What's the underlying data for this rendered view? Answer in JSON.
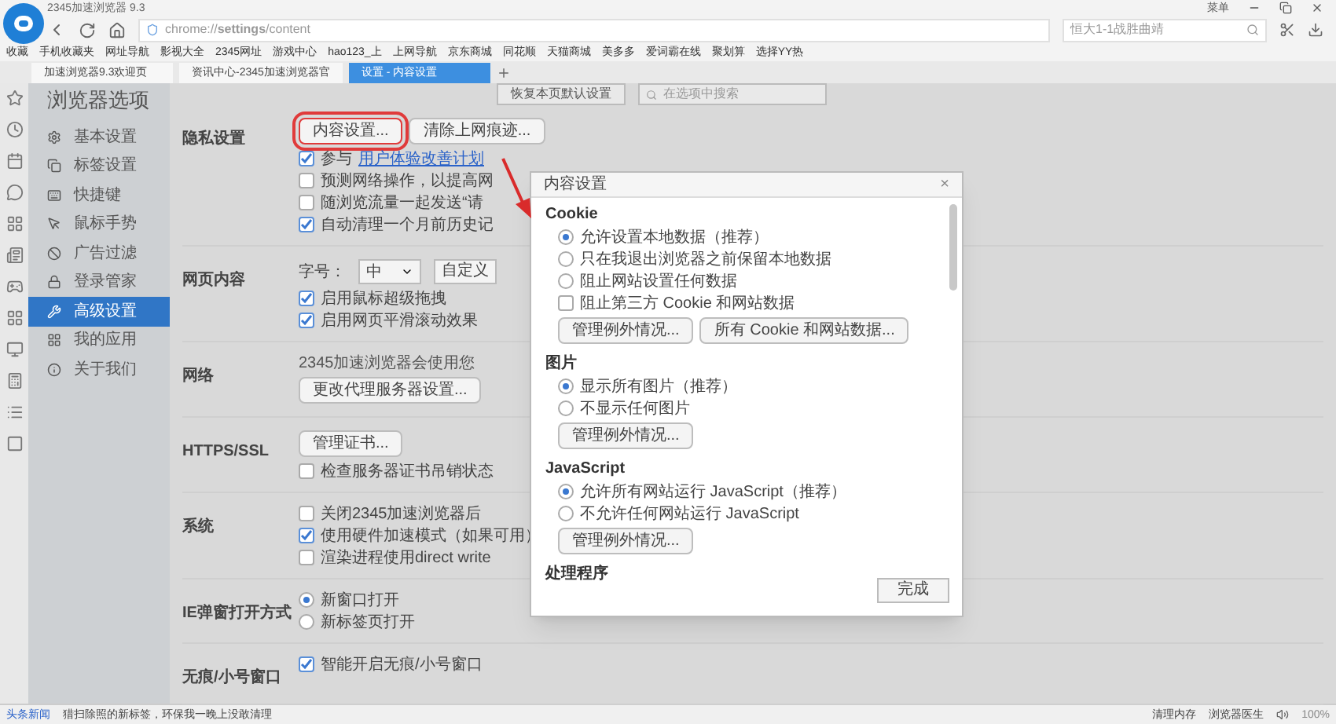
{
  "window": {
    "title": "2345加速浏览器 9.3",
    "menu": "菜单"
  },
  "address": {
    "url": "chrome://**settings**/content"
  },
  "search": {
    "value": "恒大1-1战胜曲靖"
  },
  "bookmarks": [
    "收藏",
    "手机收藏夹",
    "网址导航",
    "影视大全",
    "2345网址",
    "游戏中心",
    "hao123_上",
    "上网导航",
    "京东商城",
    "同花顺",
    "天猫商城",
    "美多多",
    "爱词霸在线",
    "聚划算",
    "选择YY热"
  ],
  "tabs": [
    {
      "label": "加速浏览器9.3欢迎页",
      "selected": false
    },
    {
      "label": "资讯中心-2345加速浏览器官",
      "selected": false
    },
    {
      "label": "设置 - 内容设置",
      "selected": true
    }
  ],
  "page": {
    "title": "浏览器选项",
    "reset_button": "恢复本页默认设置",
    "search_placeholder": "在选项中搜索"
  },
  "sidebar": {
    "items": [
      {
        "label": "基本设置",
        "selected": false
      },
      {
        "label": "标签设置",
        "selected": false
      },
      {
        "label": "快捷键",
        "selected": false
      },
      {
        "label": "鼠标手势",
        "selected": false
      },
      {
        "label": "广告过滤",
        "selected": false
      },
      {
        "label": "登录管家",
        "selected": false
      },
      {
        "label": "高级设置",
        "selected": true
      },
      {
        "label": "我的应用",
        "selected": false
      },
      {
        "label": "关于我们",
        "selected": false
      }
    ]
  },
  "sections": [
    {
      "label": "隐私设置",
      "rows": [
        {
          "kind": "buttons",
          "buttons": [
            {
              "label": "内容设置...",
              "highlighted": true
            },
            {
              "label": "清除上网痕迹...",
              "highlighted": false
            }
          ]
        },
        {
          "kind": "checkbox",
          "label": "参与",
          "link": "用户体验改善计划",
          "checked": true
        },
        {
          "kind": "checkbox",
          "label": "预测网络操作，以提高网",
          "checked": false
        },
        {
          "kind": "checkbox",
          "label": "随浏览流量一起发送“请",
          "checked": false
        },
        {
          "kind": "checkbox",
          "label": "自动清理一个月前历史记",
          "checked": true
        }
      ]
    },
    {
      "label": "网页内容",
      "rows": [
        {
          "kind": "select",
          "label": "字号：",
          "value": "中",
          "button": "自定义"
        },
        {
          "kind": "checkbox",
          "label": "启用鼠标超级拖拽",
          "checked": true
        },
        {
          "kind": "checkbox",
          "label": "启用网页平滑滚动效果",
          "checked": true
        }
      ]
    },
    {
      "label": "网络",
      "rows": [
        {
          "kind": "text",
          "label": "2345加速浏览器会使用您"
        },
        {
          "kind": "buttons",
          "buttons": [
            {
              "label": "更改代理服务器设置...",
              "highlighted": false
            }
          ]
        }
      ]
    },
    {
      "label": "HTTPS/SSL",
      "rows": [
        {
          "kind": "buttons",
          "buttons": [
            {
              "label": "管理证书...",
              "highlighted": false
            }
          ]
        },
        {
          "kind": "checkbox",
          "label": "检查服务器证书吊销状态",
          "checked": false
        }
      ]
    },
    {
      "label": "系统",
      "rows": [
        {
          "kind": "checkbox",
          "label": "关闭2345加速浏览器后",
          "checked": false
        },
        {
          "kind": "checkbox",
          "label": "使用硬件加速模式（如果可用）",
          "checked": true
        },
        {
          "kind": "checkbox",
          "label": "渲染进程使用direct write",
          "checked": false
        }
      ]
    },
    {
      "label": "IE弹窗打开方式",
      "rows": [
        {
          "kind": "radio",
          "label": "新窗口打开",
          "selected": true
        },
        {
          "kind": "radio",
          "label": "新标签页打开",
          "selected": false
        }
      ]
    },
    {
      "label": "无痕/小号窗口",
      "rows": [
        {
          "kind": "checkbox",
          "label": "智能开启无痕/小号窗口",
          "checked": true
        }
      ]
    }
  ],
  "dialog": {
    "title": "内容设置",
    "close": "×",
    "done": "完成",
    "groups": [
      {
        "title": "Cookie",
        "rows": [
          {
            "kind": "radio",
            "label": "允许设置本地数据（推荐）",
            "selected": true
          },
          {
            "kind": "radio",
            "label": "只在我退出浏览器之前保留本地数据",
            "selected": false
          },
          {
            "kind": "radio",
            "label": "阻止网站设置任何数据",
            "selected": false
          },
          {
            "kind": "checkbox",
            "label": "阻止第三方 Cookie 和网站数据",
            "checked": false
          },
          {
            "kind": "buttons",
            "buttons": [
              {
                "label": "管理例外情况...",
                "highlighted": false
              },
              {
                "label": "所有 Cookie 和网站数据...",
                "highlighted": false
              }
            ]
          }
        ]
      },
      {
        "title": "图片",
        "rows": [
          {
            "kind": "radio",
            "label": "显示所有图片（推荐）",
            "selected": true
          },
          {
            "kind": "radio",
            "label": "不显示任何图片",
            "selected": false
          },
          {
            "kind": "buttons",
            "buttons": [
              {
                "label": "管理例外情况...",
                "highlighted": false
              }
            ]
          }
        ]
      },
      {
        "title": "JavaScript",
        "rows": [
          {
            "kind": "radio",
            "label": "允许所有网站运行 JavaScript（推荐）",
            "selected": true
          },
          {
            "kind": "radio",
            "label": "不允许任何网站运行 JavaScript",
            "selected": false
          },
          {
            "kind": "buttons",
            "buttons": [
              {
                "label": "管理例外情况...",
                "highlighted": false
              }
            ]
          }
        ]
      },
      {
        "title": "处理程序"
      }
    ]
  },
  "status_bar": {
    "news_label": "头条新闻",
    "headline": "猎扫除照的新标签，环保我一晚上没敢清理",
    "items": [
      "清理内存",
      "浏览器医生"
    ],
    "zoom": "100%"
  }
}
